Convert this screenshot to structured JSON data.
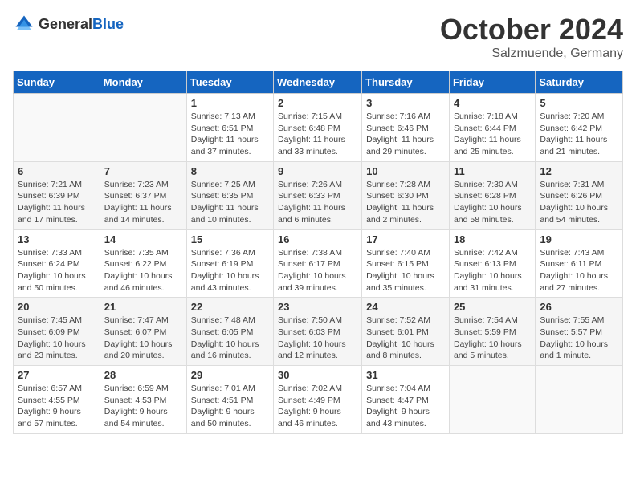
{
  "header": {
    "logo_general": "General",
    "logo_blue": "Blue",
    "month": "October 2024",
    "location": "Salzmuende, Germany"
  },
  "days_of_week": [
    "Sunday",
    "Monday",
    "Tuesday",
    "Wednesday",
    "Thursday",
    "Friday",
    "Saturday"
  ],
  "weeks": [
    [
      {
        "day": "",
        "info": ""
      },
      {
        "day": "",
        "info": ""
      },
      {
        "day": "1",
        "info": "Sunrise: 7:13 AM\nSunset: 6:51 PM\nDaylight: 11 hours\nand 37 minutes."
      },
      {
        "day": "2",
        "info": "Sunrise: 7:15 AM\nSunset: 6:48 PM\nDaylight: 11 hours\nand 33 minutes."
      },
      {
        "day": "3",
        "info": "Sunrise: 7:16 AM\nSunset: 6:46 PM\nDaylight: 11 hours\nand 29 minutes."
      },
      {
        "day": "4",
        "info": "Sunrise: 7:18 AM\nSunset: 6:44 PM\nDaylight: 11 hours\nand 25 minutes."
      },
      {
        "day": "5",
        "info": "Sunrise: 7:20 AM\nSunset: 6:42 PM\nDaylight: 11 hours\nand 21 minutes."
      }
    ],
    [
      {
        "day": "6",
        "info": "Sunrise: 7:21 AM\nSunset: 6:39 PM\nDaylight: 11 hours\nand 17 minutes."
      },
      {
        "day": "7",
        "info": "Sunrise: 7:23 AM\nSunset: 6:37 PM\nDaylight: 11 hours\nand 14 minutes."
      },
      {
        "day": "8",
        "info": "Sunrise: 7:25 AM\nSunset: 6:35 PM\nDaylight: 11 hours\nand 10 minutes."
      },
      {
        "day": "9",
        "info": "Sunrise: 7:26 AM\nSunset: 6:33 PM\nDaylight: 11 hours\nand 6 minutes."
      },
      {
        "day": "10",
        "info": "Sunrise: 7:28 AM\nSunset: 6:30 PM\nDaylight: 11 hours\nand 2 minutes."
      },
      {
        "day": "11",
        "info": "Sunrise: 7:30 AM\nSunset: 6:28 PM\nDaylight: 10 hours\nand 58 minutes."
      },
      {
        "day": "12",
        "info": "Sunrise: 7:31 AM\nSunset: 6:26 PM\nDaylight: 10 hours\nand 54 minutes."
      }
    ],
    [
      {
        "day": "13",
        "info": "Sunrise: 7:33 AM\nSunset: 6:24 PM\nDaylight: 10 hours\nand 50 minutes."
      },
      {
        "day": "14",
        "info": "Sunrise: 7:35 AM\nSunset: 6:22 PM\nDaylight: 10 hours\nand 46 minutes."
      },
      {
        "day": "15",
        "info": "Sunrise: 7:36 AM\nSunset: 6:19 PM\nDaylight: 10 hours\nand 43 minutes."
      },
      {
        "day": "16",
        "info": "Sunrise: 7:38 AM\nSunset: 6:17 PM\nDaylight: 10 hours\nand 39 minutes."
      },
      {
        "day": "17",
        "info": "Sunrise: 7:40 AM\nSunset: 6:15 PM\nDaylight: 10 hours\nand 35 minutes."
      },
      {
        "day": "18",
        "info": "Sunrise: 7:42 AM\nSunset: 6:13 PM\nDaylight: 10 hours\nand 31 minutes."
      },
      {
        "day": "19",
        "info": "Sunrise: 7:43 AM\nSunset: 6:11 PM\nDaylight: 10 hours\nand 27 minutes."
      }
    ],
    [
      {
        "day": "20",
        "info": "Sunrise: 7:45 AM\nSunset: 6:09 PM\nDaylight: 10 hours\nand 23 minutes."
      },
      {
        "day": "21",
        "info": "Sunrise: 7:47 AM\nSunset: 6:07 PM\nDaylight: 10 hours\nand 20 minutes."
      },
      {
        "day": "22",
        "info": "Sunrise: 7:48 AM\nSunset: 6:05 PM\nDaylight: 10 hours\nand 16 minutes."
      },
      {
        "day": "23",
        "info": "Sunrise: 7:50 AM\nSunset: 6:03 PM\nDaylight: 10 hours\nand 12 minutes."
      },
      {
        "day": "24",
        "info": "Sunrise: 7:52 AM\nSunset: 6:01 PM\nDaylight: 10 hours\nand 8 minutes."
      },
      {
        "day": "25",
        "info": "Sunrise: 7:54 AM\nSunset: 5:59 PM\nDaylight: 10 hours\nand 5 minutes."
      },
      {
        "day": "26",
        "info": "Sunrise: 7:55 AM\nSunset: 5:57 PM\nDaylight: 10 hours\nand 1 minute."
      }
    ],
    [
      {
        "day": "27",
        "info": "Sunrise: 6:57 AM\nSunset: 4:55 PM\nDaylight: 9 hours\nand 57 minutes."
      },
      {
        "day": "28",
        "info": "Sunrise: 6:59 AM\nSunset: 4:53 PM\nDaylight: 9 hours\nand 54 minutes."
      },
      {
        "day": "29",
        "info": "Sunrise: 7:01 AM\nSunset: 4:51 PM\nDaylight: 9 hours\nand 50 minutes."
      },
      {
        "day": "30",
        "info": "Sunrise: 7:02 AM\nSunset: 4:49 PM\nDaylight: 9 hours\nand 46 minutes."
      },
      {
        "day": "31",
        "info": "Sunrise: 7:04 AM\nSunset: 4:47 PM\nDaylight: 9 hours\nand 43 minutes."
      },
      {
        "day": "",
        "info": ""
      },
      {
        "day": "",
        "info": ""
      }
    ]
  ]
}
